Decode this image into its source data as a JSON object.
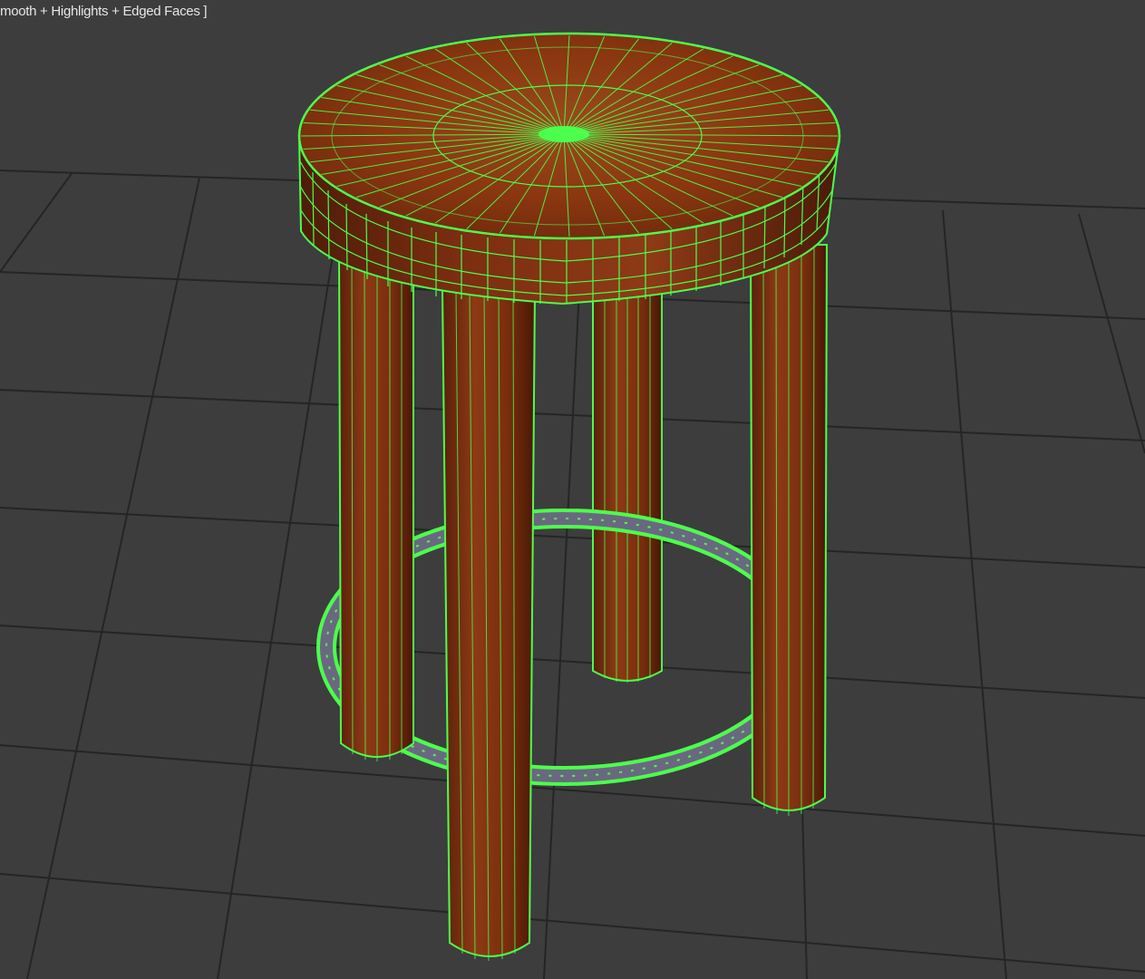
{
  "viewport": {
    "label": "mooth + Highlights + Edged Faces ]",
    "shading_mode": "Smooth + Highlights + Edged Faces"
  },
  "scene": {
    "object": "wooden-bar-stool",
    "wireframe_color": "#4cff4c",
    "wood_color": "#8a3410",
    "grid_color": "#262626",
    "background_color": "#3d3d3d"
  }
}
